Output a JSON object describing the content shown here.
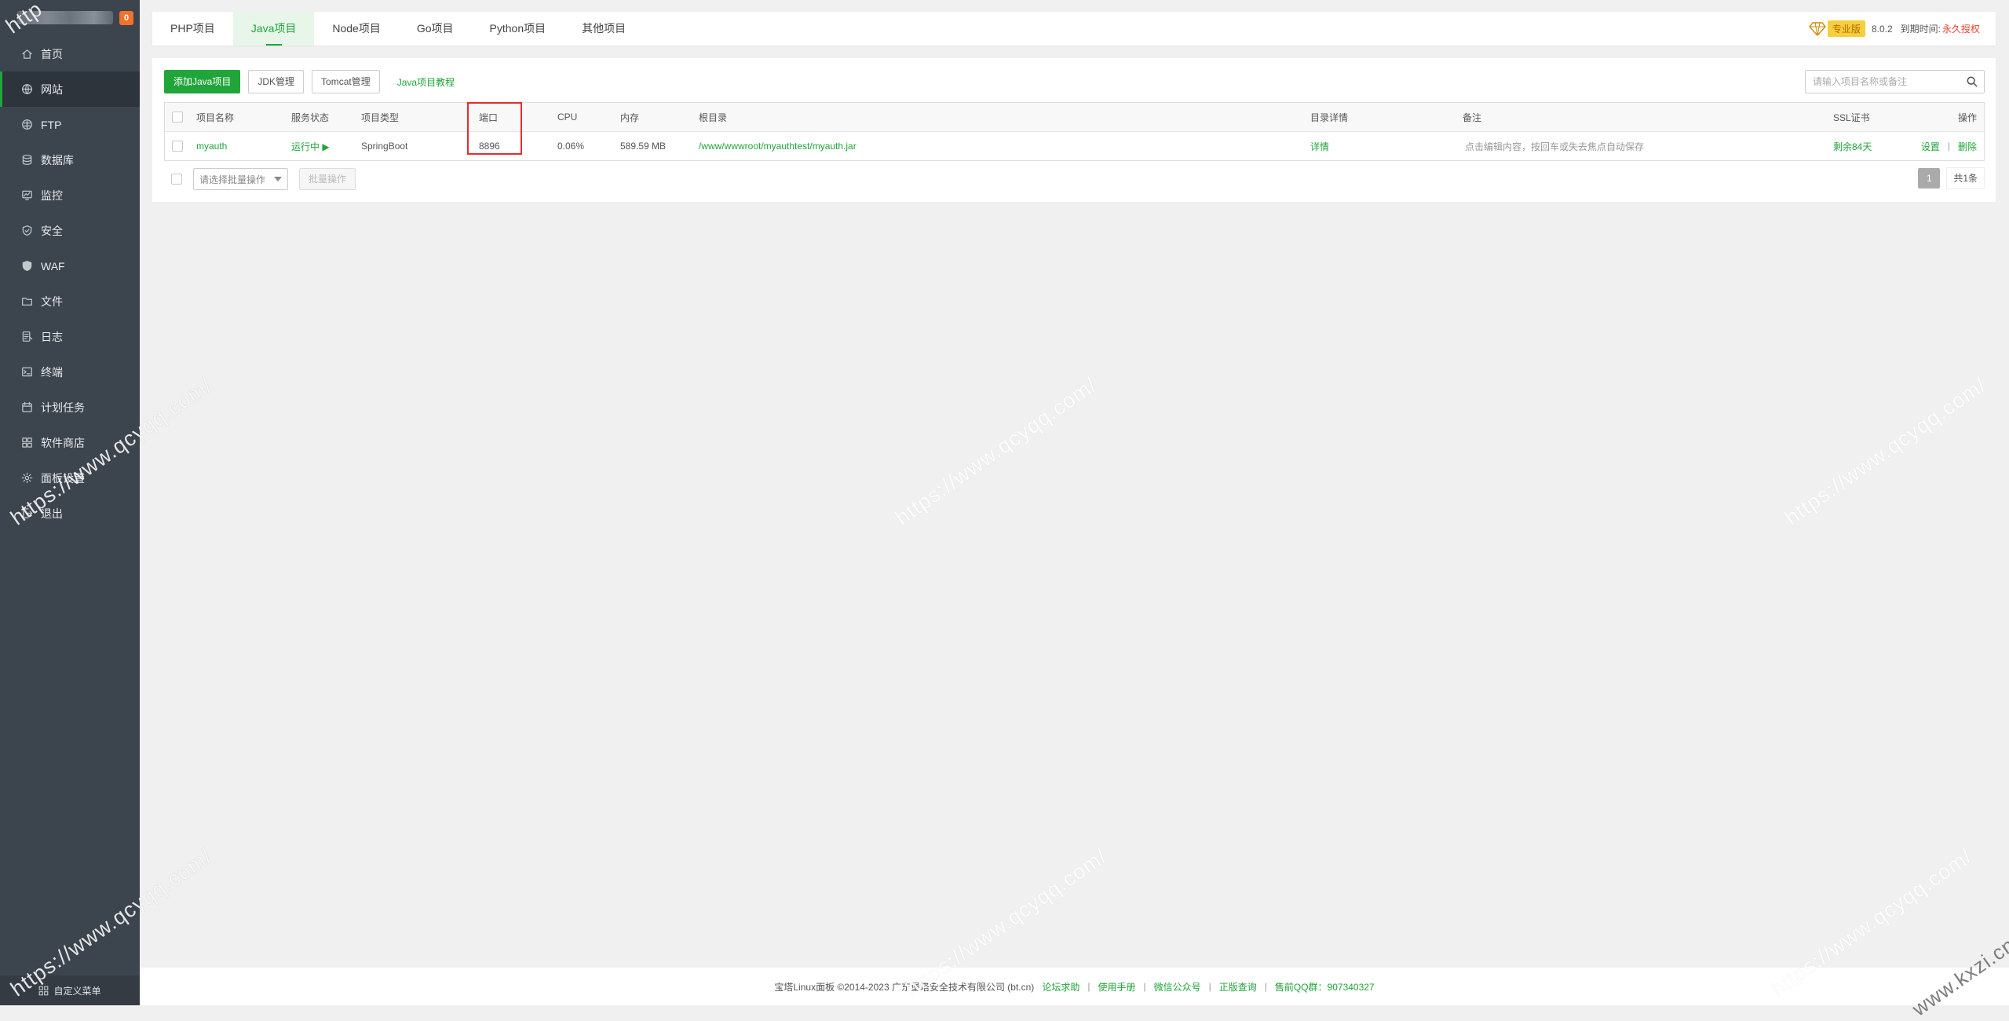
{
  "sidebar": {
    "badge": "0",
    "items": [
      {
        "label": "首页",
        "icon": "home-icon"
      },
      {
        "label": "网站",
        "icon": "globe-icon",
        "active": true
      },
      {
        "label": "FTP",
        "icon": "ftp-icon"
      },
      {
        "label": "数据库",
        "icon": "database-icon"
      },
      {
        "label": "监控",
        "icon": "monitor-icon"
      },
      {
        "label": "安全",
        "icon": "shield-icon"
      },
      {
        "label": "WAF",
        "icon": "waf-shield-icon"
      },
      {
        "label": "文件",
        "icon": "folder-icon"
      },
      {
        "label": "日志",
        "icon": "log-icon"
      },
      {
        "label": "终端",
        "icon": "terminal-icon"
      },
      {
        "label": "计划任务",
        "icon": "calendar-icon"
      },
      {
        "label": "软件商店",
        "icon": "apps-icon"
      },
      {
        "label": "面板设置",
        "icon": "gear-icon"
      },
      {
        "label": "退出",
        "icon": "logout-icon"
      }
    ],
    "custom_menu": "自定义菜单"
  },
  "tabs": [
    "PHP项目",
    "Java项目",
    "Node项目",
    "Go项目",
    "Python项目",
    "其他项目"
  ],
  "active_tab": "Java项目",
  "header_right": {
    "edition": "专业版",
    "version": "8.0.2",
    "expire_label": "到期时间:",
    "expire_value": "永久授权"
  },
  "toolbar": {
    "add_button": "添加Java项目",
    "jdk_button": "JDK管理",
    "tomcat_button": "Tomcat管理",
    "tutorial_link": "Java项目教程"
  },
  "search": {
    "placeholder": "请输入项目名称或备注"
  },
  "table": {
    "headers": {
      "name": "项目名称",
      "status": "服务状态",
      "type": "项目类型",
      "port": "端口",
      "cpu": "CPU",
      "mem": "内存",
      "root": "根目录",
      "detail": "目录详情",
      "note": "备注",
      "ssl": "SSL证书",
      "action": "操作"
    },
    "rows": [
      {
        "name": "myauth",
        "status": "运行中 ▶",
        "type": "SpringBoot",
        "port": "8896",
        "cpu": "0.06%",
        "mem": "589.59 MB",
        "root": "/www/wwwroot/myauthtest/myauth.jar",
        "detail": "详情",
        "note": "点击编辑内容，按回车或失去焦点自动保存",
        "ssl": "剩余84天",
        "action_set": "设置",
        "action_sep": "|",
        "action_del": "删除"
      }
    ]
  },
  "bulk": {
    "select_placeholder": "请选择批量操作",
    "button": "批量操作"
  },
  "pager": {
    "page": "1",
    "total": "共1条"
  },
  "footer": {
    "copyright": "宝塔Linux面板 ©2014-2023 广东堡塔安全技术有限公司 (bt.cn)",
    "links": [
      "论坛求助",
      "使用手册",
      "微信公众号",
      "正版查询"
    ],
    "qq": "售前QQ群：907340327",
    "sep": "|"
  },
  "watermarks": [
    "http",
    "https://www.qcyqq.com/",
    "https://www.qcyqq.com/",
    "https://www.qcyqq.com/",
    "https://www.qcyqq.com/",
    "https://www.qcyqq.com/",
    "https://www.qcyqq.com/",
    "www.kxzi.cn"
  ],
  "colors": {
    "accent": "#20a53a",
    "sidebar": "#3c444d",
    "highlight_box": "#e52d2d",
    "edition_bg": "#f5cf3d"
  }
}
